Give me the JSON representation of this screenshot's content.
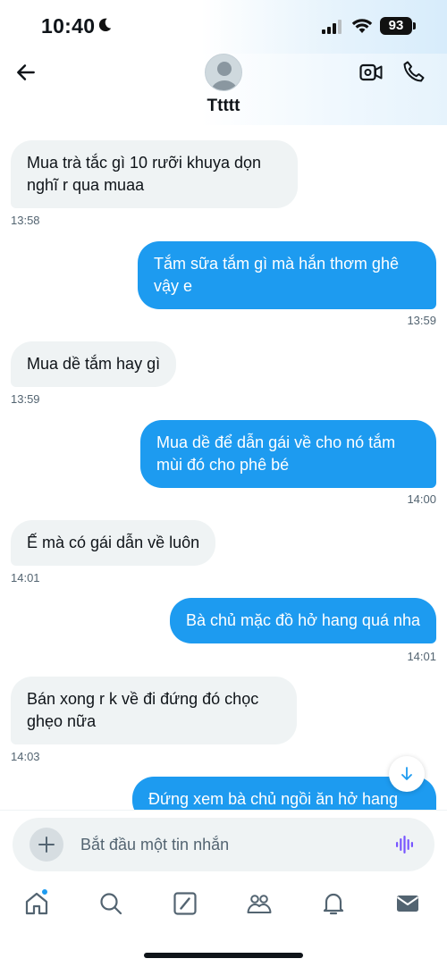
{
  "status_bar": {
    "time": "10:40",
    "battery": "93"
  },
  "header": {
    "contact_name": "Ttttt"
  },
  "messages": [
    {
      "dir": "in",
      "text": "Mua trà tắc gì 10 rưỡi khuya dọn nghĩ r qua muaa",
      "time": "13:58"
    },
    {
      "dir": "out",
      "text": "Tắm sữa tắm gì mà hắn thơm ghê vậy e",
      "time": "13:59"
    },
    {
      "dir": "in",
      "text": "Mua dề tắm hay gì",
      "time": "13:59"
    },
    {
      "dir": "out",
      "text": "Mua dề để dẫn gái về cho nó tắm mùi đó cho phê bé",
      "time": "14:00"
    },
    {
      "dir": "in",
      "text": "Ế mà có gái dẫn về luôn",
      "time": "14:01"
    },
    {
      "dir": "out",
      "text": "Bà chủ mặc đồ hở hang quá nha",
      "time": "14:01"
    },
    {
      "dir": "in",
      "text": "Bán xong r k về đi đứng đó chọc ghẹo nữa",
      "time": "14:03"
    },
    {
      "dir": "out",
      "text": "Đứng xem bà chủ ngồi ăn hở hang",
      "time": ""
    }
  ],
  "composer": {
    "placeholder": "Bắt đầu một tin nhắn"
  },
  "nav": {
    "items": [
      "home-icon",
      "search-icon",
      "grok-icon",
      "communities-icon",
      "notifications-icon",
      "messages-icon"
    ]
  },
  "colors": {
    "accent": "#1d9bf0",
    "incoming_bubble": "#eff3f4",
    "voice": "#7856ff"
  }
}
